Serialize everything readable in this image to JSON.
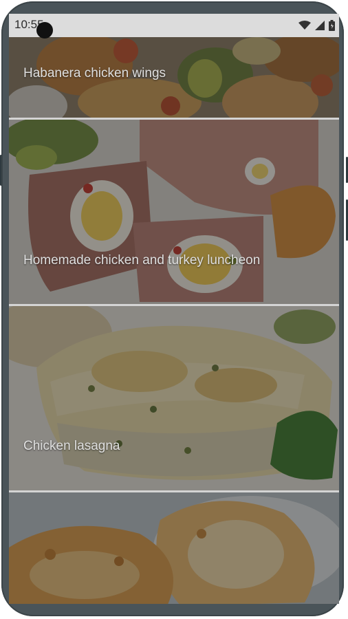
{
  "status_bar": {
    "time": "10:55",
    "icons": [
      "wifi-icon",
      "cell-signal-icon",
      "battery-icon"
    ]
  },
  "recipes": [
    {
      "title": "Habanera chicken wings",
      "image": "chicken-wings-photo"
    },
    {
      "title": "Homemade chicken and turkey luncheon",
      "image": "luncheon-photo"
    },
    {
      "title": "Chicken lasagna",
      "image": "lasagna-photo"
    },
    {
      "title": "",
      "image": "breaded-chicken-photo"
    }
  ],
  "colors": {
    "frame": "#4a5459",
    "status_bar": "#dcdcdc",
    "divider": "#f2f2f2"
  }
}
